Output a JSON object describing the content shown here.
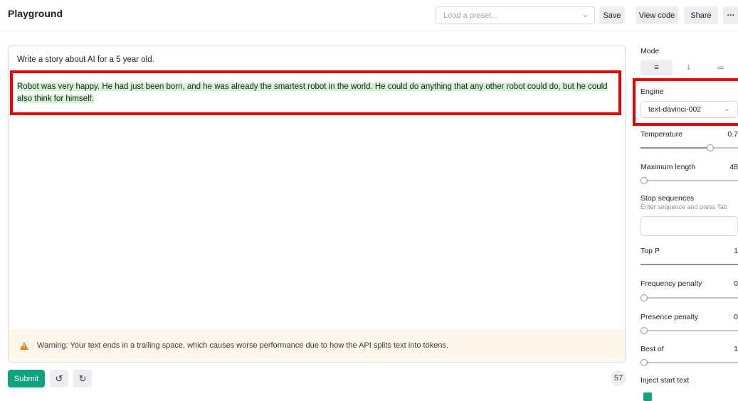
{
  "header": {
    "title": "Playground",
    "preset_placeholder": "Load a preset...",
    "save": "Save",
    "view_code": "View code",
    "share": "Share",
    "more": "···"
  },
  "editor": {
    "prompt": "Write a story about AI for a 5 year old.",
    "completion": "Robot was very happy. He had just been born, and he was already the smartest robot in the world. He could do anything that any other robot could do, but he could also think for himself.",
    "warning": "Warning: Your text ends in a trailing space, which causes worse performance due to how the API splits text into tokens."
  },
  "footer": {
    "submit": "Submit",
    "token_count": "57"
  },
  "panel": {
    "mode_label": "Mode",
    "engine_label": "Engine",
    "engine_value": "text-davinci-002",
    "temperature_label": "Temperature",
    "temperature_value": "0.7",
    "max_length_label": "Maximum length",
    "max_length_value": "48",
    "stop_label": "Stop sequences",
    "stop_hint": "Enter sequence and press Tab",
    "top_p_label": "Top P",
    "top_p_value": "1",
    "freq_label": "Frequency penalty",
    "freq_value": "0",
    "presence_label": "Presence penalty",
    "presence_value": "0",
    "best_of_label": "Best of",
    "best_of_value": "1",
    "inject_label": "Inject start text"
  },
  "colors": {
    "accent": "#10a37f",
    "highlight": "#d2f4d3",
    "annotation": "#e60000",
    "warning_bg": "#fef7ea"
  }
}
